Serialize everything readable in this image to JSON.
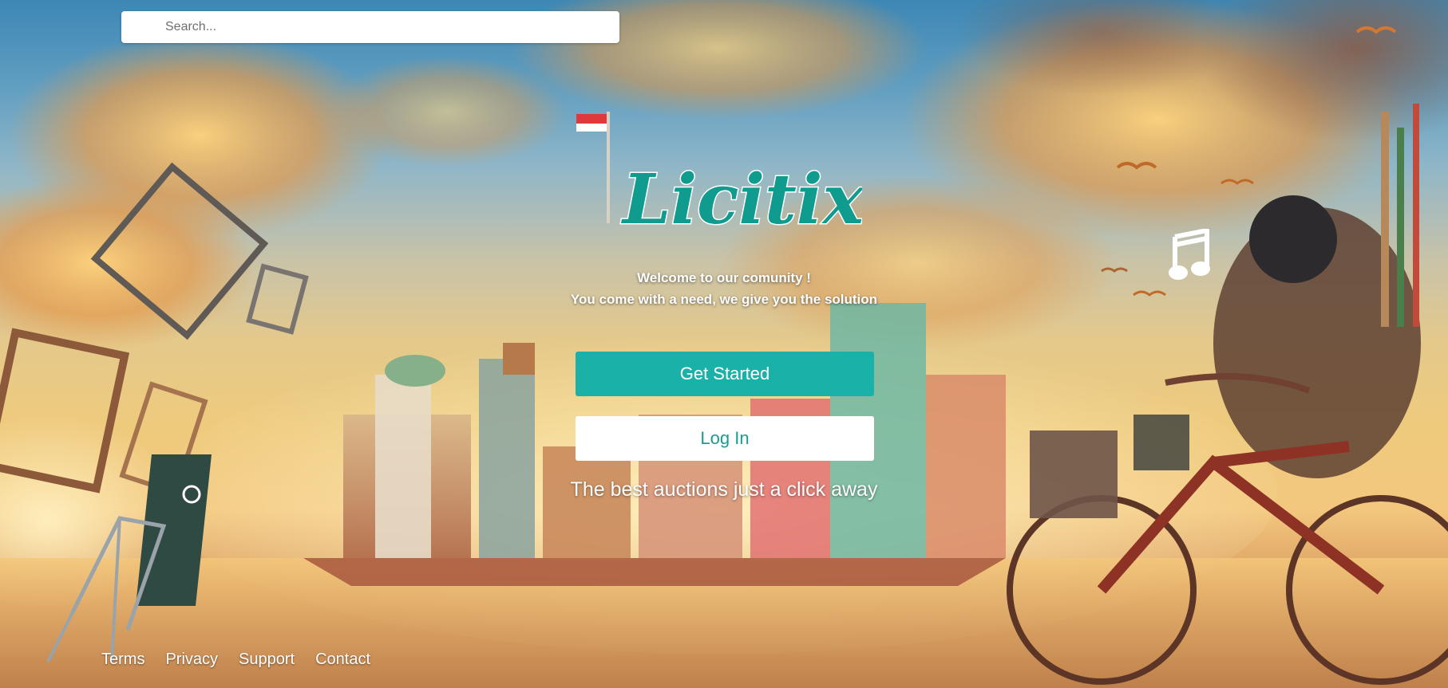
{
  "search": {
    "placeholder": "Search..."
  },
  "brand": {
    "logo_text": "Licitix",
    "logo_color": "#0f9b8e",
    "logo_accent_color": "#f2a71b"
  },
  "hero": {
    "welcome_line1": "Welcome to our comunity !",
    "welcome_line2": "You come with a need, we give you the solution",
    "tagline": "The best auctions just a click away"
  },
  "actions": {
    "get_started_label": "Get Started",
    "login_label": "Log In",
    "primary_color": "#1ab2a8"
  },
  "audio": {
    "icon": "music-note-icon"
  },
  "footer": {
    "links": [
      "Terms",
      "Privacy",
      "Support",
      "Contact"
    ]
  }
}
